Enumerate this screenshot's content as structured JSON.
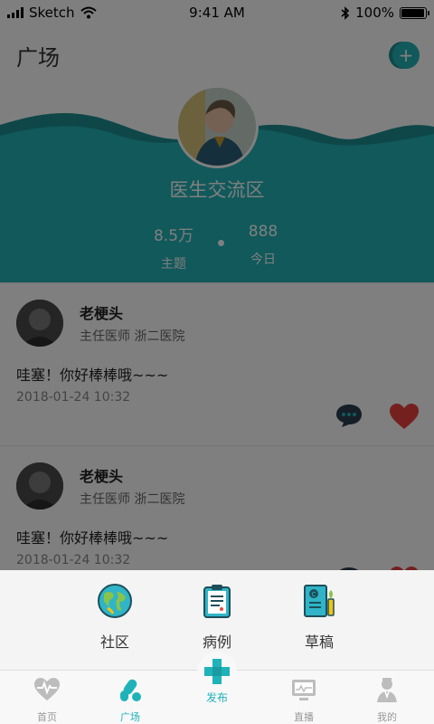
{
  "status_bar": {
    "carrier": "Sketch",
    "time": "9:41 AM",
    "battery": "100%",
    "battery_level": 1.0
  },
  "nav": {
    "title": "广场",
    "add_icon": "plus-circle-icon"
  },
  "forum": {
    "name": "医生交流区",
    "stats": [
      {
        "value": "8.5万",
        "label": "主题"
      },
      {
        "value": "888",
        "label": "今日"
      }
    ]
  },
  "posts": [
    {
      "author": "老梗头",
      "meta": "主任医师  浙二医院",
      "content": "哇塞！你好棒棒哦~~~",
      "time": "2018-01-24  10:32"
    },
    {
      "author": "老梗头",
      "meta": "主任医师  浙二医院",
      "content": "哇塞！你好棒棒哦~~~",
      "time": "2018-01-24  10:32"
    }
  ],
  "publish_menu": [
    {
      "label": "社区",
      "icon": "globe-icon"
    },
    {
      "label": "病例",
      "icon": "clipboard-icon"
    },
    {
      "label": "草稿",
      "icon": "draft-book-icon"
    }
  ],
  "tabbar": {
    "tabs": [
      {
        "label": "首页",
        "icon": "heart-pulse-icon"
      },
      {
        "label": "广场",
        "icon": "pills-icon"
      },
      {
        "label": "发布",
        "icon": "medical-cross-icon"
      },
      {
        "label": "直播",
        "icon": "monitor-icon"
      },
      {
        "label": "我的",
        "icon": "doctor-icon"
      }
    ],
    "active": "广场"
  },
  "colors": {
    "teal": "#22b3b6",
    "teal_dark": "#1f8f92",
    "like_red": "#e8403e",
    "tab_active": "#1fb3b9"
  }
}
